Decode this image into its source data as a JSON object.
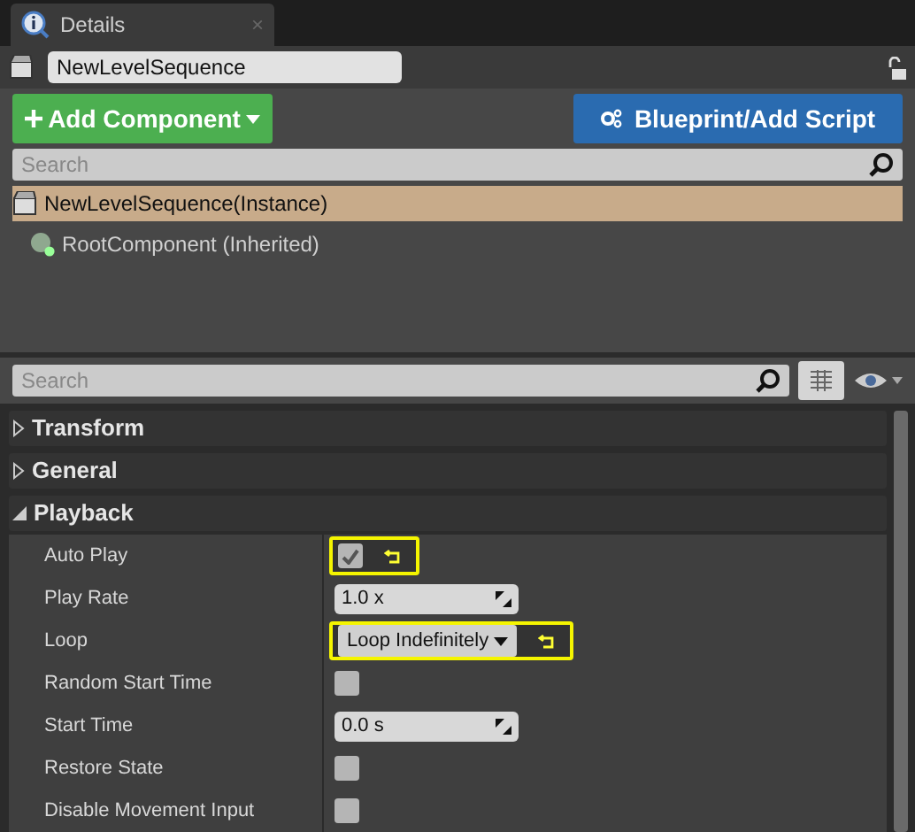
{
  "tab": {
    "label": "Details",
    "close": "×"
  },
  "object_name": "NewLevelSequence",
  "buttons": {
    "add": "Add Component",
    "blueprint": "Blueprint/Add Script"
  },
  "component_search": {
    "placeholder": "Search"
  },
  "components": [
    {
      "label": "NewLevelSequence(Instance)",
      "selected": true,
      "kind": "actor"
    },
    {
      "label": "RootComponent (Inherited)",
      "selected": false,
      "kind": "scene"
    }
  ],
  "details_search": {
    "placeholder": "Search"
  },
  "categories": [
    {
      "label": "Transform",
      "expanded": false
    },
    {
      "label": "General",
      "expanded": false
    },
    {
      "label": "Playback",
      "expanded": true,
      "properties": [
        {
          "label": "Auto Play",
          "kind": "checkbox",
          "checked": true,
          "highlighted": true
        },
        {
          "label": "Play Rate",
          "kind": "number",
          "value": "1.0 x",
          "highlighted": false
        },
        {
          "label": "Loop",
          "kind": "dropdown",
          "value": "Loop Indefinitely",
          "highlighted": true
        },
        {
          "label": "Random Start Time",
          "kind": "checkbox",
          "checked": false,
          "highlighted": false
        },
        {
          "label": "Start Time",
          "kind": "number",
          "value": "0.0 s",
          "highlighted": false
        },
        {
          "label": "Restore State",
          "kind": "checkbox",
          "checked": false,
          "highlighted": false
        },
        {
          "label": "Disable Movement Input",
          "kind": "checkbox",
          "checked": false,
          "highlighted": false
        }
      ]
    }
  ]
}
